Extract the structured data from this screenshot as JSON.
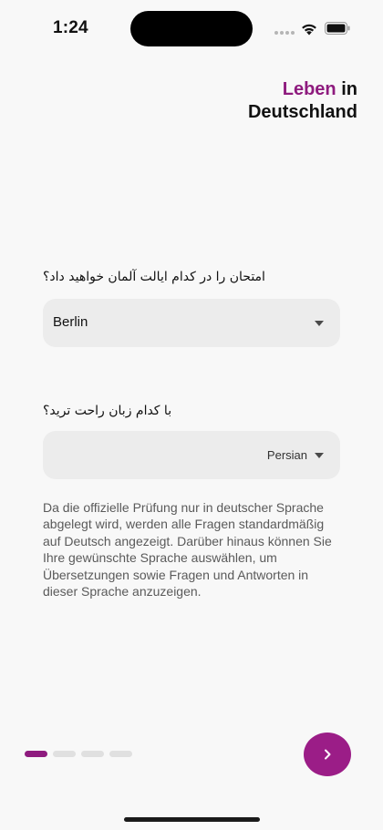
{
  "status_bar": {
    "time": "1:24"
  },
  "brand": {
    "word1": "Leben",
    "word2": "in",
    "word3": "Deutschland",
    "accent_color": "#8e1b7e"
  },
  "state_question": {
    "label": "امتحان را در کدام ایالت آلمان خواهید داد؟",
    "selected": "Berlin"
  },
  "language_question": {
    "label": "با کدام زبان راحت ترید؟",
    "selected": "Persian"
  },
  "info_text": "Da die offizielle Prüfung nur in deutscher Sprache abgelegt wird, werden alle Fragen standardmäßig auf Deutsch angezeigt. Darüber hinaus können Sie Ihre gewünschte Sprache auswählen, um Übersetzungen sowie Fragen und Antworten in dieser Sprache anzuzeigen.",
  "pager": {
    "total_pages": 4,
    "current_page": 1
  },
  "next_button": {
    "icon": "chevron-right-icon",
    "color": "#9b1d87"
  }
}
